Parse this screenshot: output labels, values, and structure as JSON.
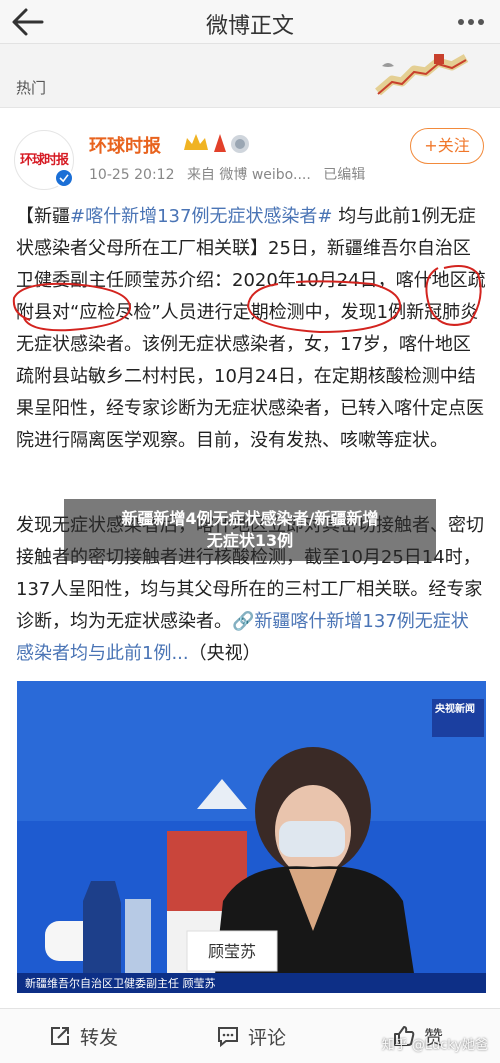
{
  "header": {
    "title": "微博正文"
  },
  "hot": {
    "label": "热门"
  },
  "post": {
    "author": "环球时报",
    "time": "10-25 20:12",
    "source": "来自 微博 weibo....",
    "edited": "已编辑",
    "follow_label": "+关注",
    "avatar_text": "环球时报",
    "p1_prefix": "【新疆",
    "p1_tag": "#喀什新增137例无症状感染者#",
    "p1_rest": " 均与此前1例无症状感染者父母所在工厂相关联】25日，新疆维吾尔自治区卫健委副主任顾莹苏介绍：2020年10月24日，喀什地区疏附县对“应检尽检”人员进行定期检测中，发现1例新冠肺炎无症状感染者。该例无症状感染者，女，17岁，喀什地区疏附县站敏乡二村村民，10月24日，在定期核酸检测中结果呈阳性，经专家诊断为无症状感染者，已转入喀什定点医院进行隔离医学观察。目前，没有发热、咳嗽等症状。",
    "p2_text": "发现无症状感染者后，喀什地区立即对其密切接触者、密切接触者的密切接触者进行核酸检测，截至10月25日14时，137人呈阳性，均与其父母所在的三村工厂相关联。经专家诊断，均为无症状感染者。",
    "p2_link": "🔗新疆喀什新增137例无症状感染者均与此前1例...",
    "p2_source": "（央视）"
  },
  "overlay": {
    "line1": "新疆新增4例无症状感染者/新疆新增",
    "line2": "无症状13例"
  },
  "photo": {
    "nameplate": "顾莹苏",
    "caption": "新疆维吾尔自治区卫健委副主任 顾莹苏",
    "logo": "央视新闻"
  },
  "actions": {
    "repost": "转发",
    "comment": "评论",
    "like": "赞"
  },
  "watermark": "知乎 @Lucky她爸",
  "colors": {
    "accent": "#f0772a",
    "tag": "#4a74b5",
    "verified": "#1b6fd6"
  }
}
